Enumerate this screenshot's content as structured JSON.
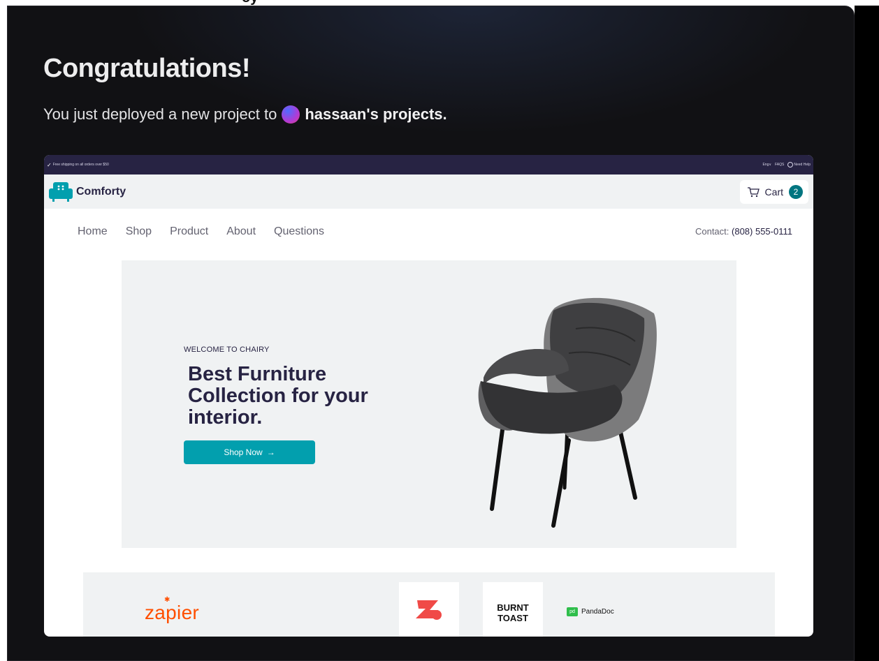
{
  "dialog": {
    "title": "Congratulations!",
    "subtitle_prefix": "You just deployed a new project to",
    "project_owner": "hassaan's projects."
  },
  "site": {
    "promo_bar": {
      "left_text": "Free shipping on all orders over $50",
      "language": "Eng∨",
      "faqs": "FAQS",
      "help": "Need Help"
    },
    "brand": "Comforty",
    "cart": {
      "label": "Cart",
      "count": "2"
    },
    "nav": {
      "items": [
        {
          "label": "Home"
        },
        {
          "label": "Shop"
        },
        {
          "label": "Product"
        },
        {
          "label": "About"
        },
        {
          "label": "Questions"
        }
      ],
      "contact_label": "Contact:",
      "contact_phone": "(808) 555-0111"
    },
    "hero": {
      "kicker": "WELCOME TO CHAIRY",
      "title": "Best Furniture Collection for your interior.",
      "cta": "Shop Now",
      "cta_arrow": "→"
    },
    "brands": {
      "zapier": "zapier",
      "burnt_toast_line1": "BURNT",
      "burnt_toast_line2": "TOAST",
      "pandadoc": "PandaDoc",
      "pandadoc_glyph": "pd"
    }
  },
  "colors": {
    "card_bg": "#111114",
    "site_primary": "#272343",
    "accent": "#029fae",
    "badge": "#007580",
    "zapier": "#ff4f00"
  }
}
